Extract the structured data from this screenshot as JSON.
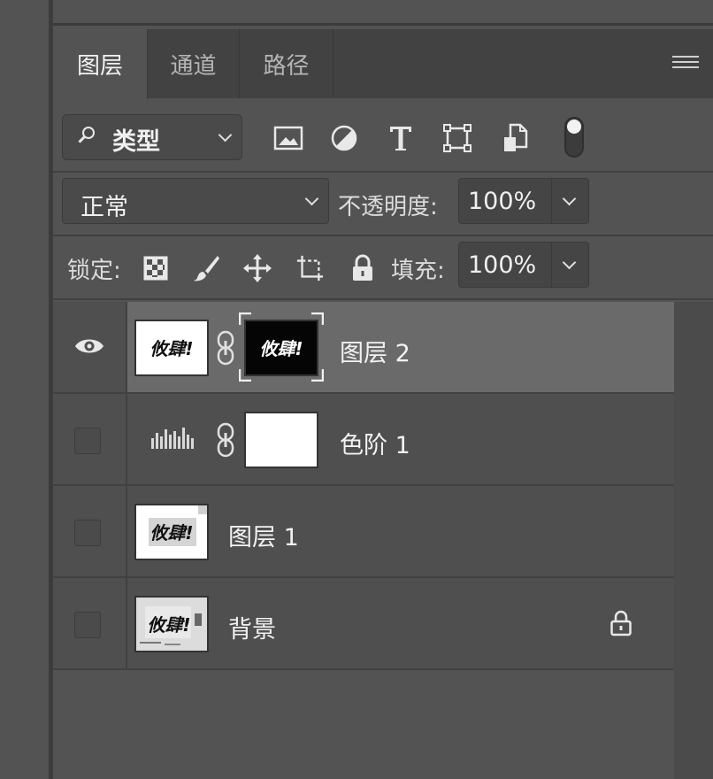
{
  "tabs": [
    {
      "label": "图层",
      "active": true
    },
    {
      "label": "通道",
      "active": false
    },
    {
      "label": "路径",
      "active": false
    }
  ],
  "filter": {
    "label": "类型"
  },
  "filter_icons": [
    "image-icon",
    "adjustment-icon",
    "text-icon",
    "shape-icon",
    "smart-object-icon"
  ],
  "blend": {
    "mode": "正常",
    "opacity_label": "不透明度:",
    "opacity_value": "100%"
  },
  "lock": {
    "label": "锁定:",
    "fill_label": "填充:",
    "fill_value": "100%"
  },
  "layers": [
    {
      "name": "图层 2",
      "visible": true,
      "selected": true,
      "thumb_text": "攸肆!"
    },
    {
      "name": "色阶 1",
      "visible": false,
      "selected": false
    },
    {
      "name": "图层 1",
      "visible": false,
      "selected": false,
      "thumb_text": "攸肆!"
    },
    {
      "name": "背景",
      "visible": false,
      "selected": false,
      "locked": true,
      "thumb_text": "攸肆!"
    }
  ],
  "colors": {
    "panel": "#535353",
    "tabbar": "#424242",
    "selected_row": "#6a6a6a",
    "text": "#f2f2f2"
  }
}
